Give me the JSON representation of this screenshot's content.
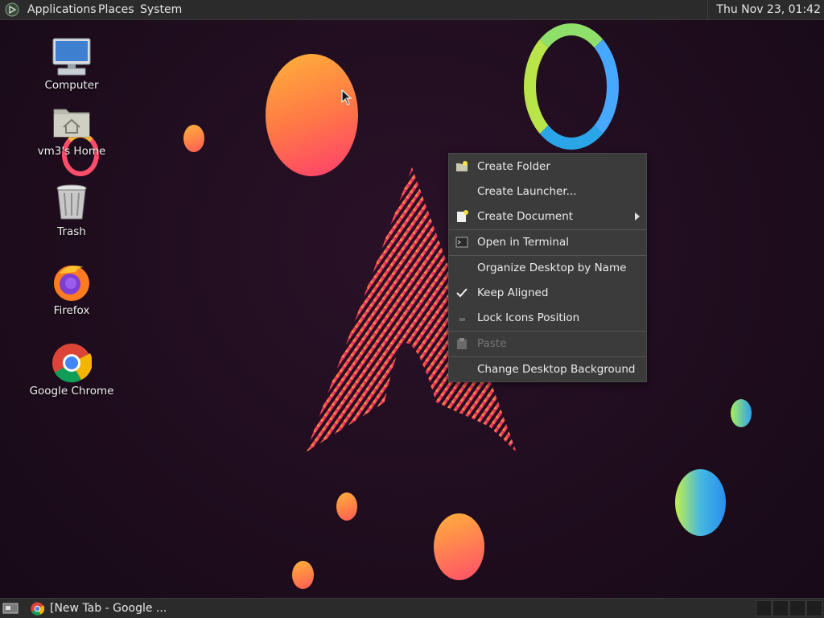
{
  "top_panel": {
    "menus": [
      "Applications",
      "Places",
      "System"
    ],
    "clock": "Thu Nov 23, 01:42"
  },
  "desktop_icons": [
    {
      "label": "Computer",
      "icon": "computer-icon"
    },
    {
      "label": "vm3's Home",
      "icon": "home-folder-icon"
    },
    {
      "label": "Trash",
      "icon": "trash-icon"
    },
    {
      "label": "Firefox",
      "icon": "firefox-icon"
    },
    {
      "label": "Google Chrome",
      "icon": "chrome-icon"
    }
  ],
  "context_menu": {
    "items": [
      {
        "label": "Create Folder",
        "icon": "folder-new-icon"
      },
      {
        "label": "Create Launcher...",
        "icon": ""
      },
      {
        "label": "Create Document",
        "icon": "document-new-icon",
        "submenu": true
      },
      {
        "label": "Open in Terminal",
        "icon": "terminal-icon"
      },
      {
        "label": "Organize Desktop by Name",
        "icon": ""
      },
      {
        "label": "Keep Aligned",
        "icon": "check-icon",
        "checked": true
      },
      {
        "label": "Lock Icons Position",
        "icon": "lock-icon"
      },
      {
        "label": "Paste",
        "icon": "paste-icon",
        "disabled": true
      },
      {
        "label": "Change Desktop Background",
        "icon": ""
      }
    ]
  },
  "taskbar": {
    "window_title": "[New Tab - Google ..."
  },
  "colors": {
    "panel_bg": "#2b2b2b",
    "menu_bg": "#3b3b3b",
    "desktop_bg": "#1f0d1e"
  }
}
